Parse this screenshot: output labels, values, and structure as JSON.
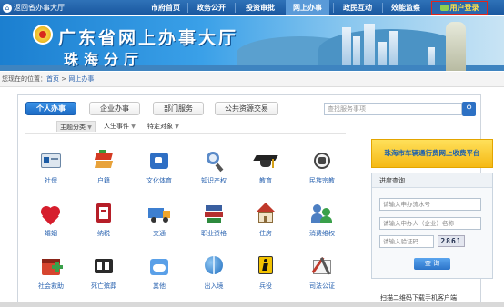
{
  "topnav": {
    "back_label": "返回省办事大厅",
    "items": [
      {
        "label": "市府首页",
        "active": false
      },
      {
        "label": "政务公开",
        "active": false
      },
      {
        "label": "投资审批",
        "active": false
      },
      {
        "label": "网上办事",
        "active": true
      },
      {
        "label": "政民互动",
        "active": false
      },
      {
        "label": "效能监察",
        "active": false
      }
    ],
    "login_label": "用户登录"
  },
  "banner": {
    "title": "广东省网上办事大厅",
    "subtitle": "珠海分厅"
  },
  "breadcrumb": {
    "prefix": "您现在的位置：",
    "home": "首页",
    "separator": " > ",
    "current": "网上办事"
  },
  "tabs": [
    {
      "label": "个人办事",
      "active": true
    },
    {
      "label": "企业办事",
      "active": false
    },
    {
      "label": "部门服务",
      "active": false
    },
    {
      "label": "公共资源交易",
      "active": false
    }
  ],
  "search": {
    "placeholder": "查找服务事项"
  },
  "subtabs": [
    {
      "label": "主题分类",
      "active": true
    },
    {
      "label": "人生事件",
      "active": false
    },
    {
      "label": "特定对象",
      "active": false
    }
  ],
  "services": [
    {
      "label": "社保",
      "icon": "social-security-icon"
    },
    {
      "label": "户籍",
      "icon": "household-register-icon"
    },
    {
      "label": "文化体育",
      "icon": "culture-sports-icon"
    },
    {
      "label": "知识产权",
      "icon": "intellectual-property-icon"
    },
    {
      "label": "教育",
      "icon": "education-icon"
    },
    {
      "label": "民族宗教",
      "icon": "ethnic-religion-icon"
    },
    {
      "label": "婚姻",
      "icon": "marriage-icon"
    },
    {
      "label": "纳税",
      "icon": "tax-icon"
    },
    {
      "label": "交通",
      "icon": "transport-icon"
    },
    {
      "label": "职业资格",
      "icon": "professional-qualification-icon"
    },
    {
      "label": "住房",
      "icon": "housing-icon"
    },
    {
      "label": "消费维权",
      "icon": "consumer-rights-icon"
    },
    {
      "label": "社会救助",
      "icon": "social-assistance-icon"
    },
    {
      "label": "死亡殡葬",
      "icon": "funeral-icon"
    },
    {
      "label": "其他",
      "icon": "other-icon"
    },
    {
      "label": "出入境",
      "icon": "entry-exit-icon"
    },
    {
      "label": "兵役",
      "icon": "military-service-icon"
    },
    {
      "label": "司法公证",
      "icon": "notary-icon"
    }
  ],
  "promo": {
    "label": "珠海市车辆通行费网上收费平台"
  },
  "progress": {
    "title": "进度查询",
    "case_placeholder": "请输入申办流水号",
    "applicant_placeholder": "请输入申办人（企业）名称",
    "code_placeholder": "请输入验证码",
    "captcha": "2861",
    "query_label": "查 询"
  },
  "qr_text": "扫描二维码下载手机客户端",
  "colors": {
    "nav": "#1a58a0",
    "accent": "#2d71c4",
    "promo": "#f5b915",
    "login_border": "#e0251b"
  }
}
